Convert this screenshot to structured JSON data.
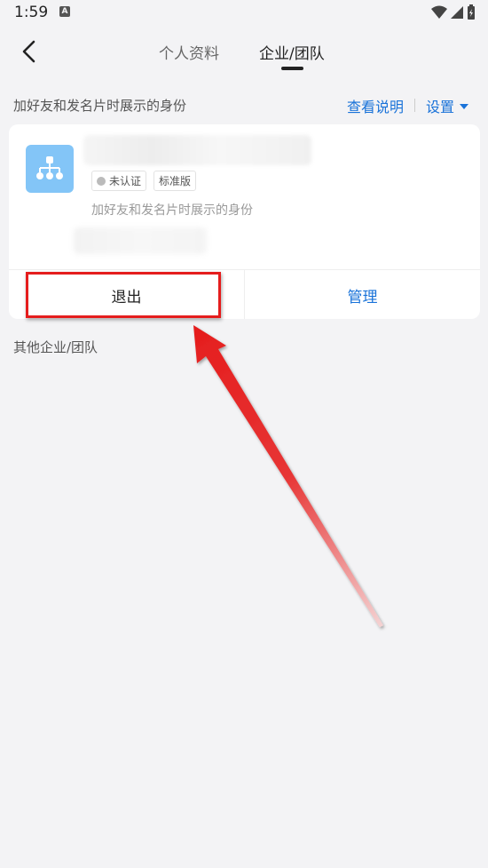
{
  "status_bar": {
    "time": "1:59",
    "notification_icon_letter": "A"
  },
  "nav": {
    "tabs": [
      {
        "label": "个人资料",
        "active": false
      },
      {
        "label": "企业/团队",
        "active": true
      }
    ]
  },
  "subheader": {
    "identity_note": "加好友和发名片时展示的身份",
    "view_desc_label": "查看说明",
    "settings_label": "设置"
  },
  "card": {
    "badges": [
      "未认证",
      "标准版"
    ],
    "description": "加好友和发名片时展示的身份",
    "actions": {
      "exit_label": "退出",
      "manage_label": "管理"
    }
  },
  "other_section_label": "其他企业/团队",
  "colors": {
    "accent": "#1a73d9",
    "avatar_bg": "#83c5f7",
    "highlight": "#e51d1d",
    "page_bg": "#f3f3f5"
  }
}
